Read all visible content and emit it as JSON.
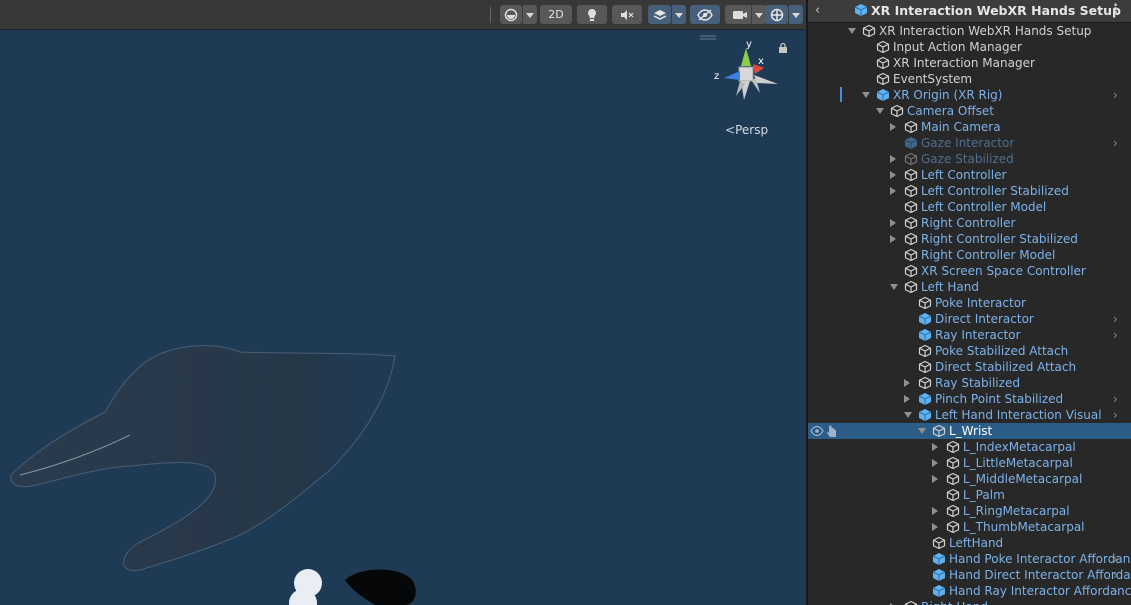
{
  "scene": {
    "toolbar": {
      "btn_2d": "2D"
    },
    "gizmo": {
      "x": "x",
      "y": "y",
      "z": "z"
    },
    "persp_label": "Persp"
  },
  "hierarchy": {
    "title": "XR Interaction WebXR Hands Setup",
    "items": [
      {
        "label": "XR Interaction WebXR Hands Setup",
        "depth": 0,
        "expand": "expanded",
        "icon": "outline",
        "color": "white",
        "chev": false
      },
      {
        "label": "Input Action Manager",
        "depth": 1,
        "expand": "none",
        "icon": "outline",
        "color": "white",
        "chev": false
      },
      {
        "label": "XR Interaction Manager",
        "depth": 1,
        "expand": "none",
        "icon": "outline",
        "color": "white",
        "chev": false
      },
      {
        "label": "EventSystem",
        "depth": 1,
        "expand": "none",
        "icon": "outline",
        "color": "white",
        "chev": false
      },
      {
        "label": "XR Origin (XR Rig)",
        "depth": 1,
        "expand": "expanded",
        "icon": "prefab",
        "color": "blue",
        "chev": true
      },
      {
        "label": "Camera Offset",
        "depth": 2,
        "expand": "expanded",
        "icon": "outline",
        "color": "blue",
        "chev": false
      },
      {
        "label": "Main Camera",
        "depth": 3,
        "expand": "collapsed",
        "icon": "outline",
        "color": "blue",
        "chev": false
      },
      {
        "label": "Gaze Interactor",
        "depth": 3,
        "expand": "none",
        "icon": "prefab",
        "color": "dim",
        "chev": true
      },
      {
        "label": "Gaze Stabilized",
        "depth": 3,
        "expand": "collapsed",
        "icon": "outline",
        "color": "dim",
        "chev": false
      },
      {
        "label": "Left Controller",
        "depth": 3,
        "expand": "collapsed",
        "icon": "outline",
        "color": "blue",
        "chev": false
      },
      {
        "label": "Left Controller Stabilized",
        "depth": 3,
        "expand": "collapsed",
        "icon": "outline",
        "color": "blue",
        "chev": false
      },
      {
        "label": "Left Controller Model",
        "depth": 3,
        "expand": "none",
        "icon": "outline",
        "color": "blue",
        "chev": false
      },
      {
        "label": "Right Controller",
        "depth": 3,
        "expand": "collapsed",
        "icon": "outline",
        "color": "blue",
        "chev": false
      },
      {
        "label": "Right Controller Stabilized",
        "depth": 3,
        "expand": "collapsed",
        "icon": "outline",
        "color": "blue",
        "chev": false
      },
      {
        "label": "Right Controller Model",
        "depth": 3,
        "expand": "none",
        "icon": "outline",
        "color": "blue",
        "chev": false
      },
      {
        "label": "XR Screen Space Controller",
        "depth": 3,
        "expand": "none",
        "icon": "outline",
        "color": "blue",
        "chev": false
      },
      {
        "label": "Left Hand",
        "depth": 3,
        "expand": "expanded",
        "icon": "outline",
        "color": "blue",
        "chev": false
      },
      {
        "label": "Poke Interactor",
        "depth": 4,
        "expand": "none",
        "icon": "outline",
        "color": "blue",
        "chev": false
      },
      {
        "label": "Direct Interactor",
        "depth": 4,
        "expand": "none",
        "icon": "prefab",
        "color": "blue",
        "chev": true
      },
      {
        "label": "Ray Interactor",
        "depth": 4,
        "expand": "none",
        "icon": "prefab",
        "color": "blue",
        "chev": true
      },
      {
        "label": "Poke Stabilized Attach",
        "depth": 4,
        "expand": "none",
        "icon": "outline",
        "color": "blue",
        "chev": false
      },
      {
        "label": "Direct Stabilized Attach",
        "depth": 4,
        "expand": "none",
        "icon": "outline",
        "color": "blue",
        "chev": false
      },
      {
        "label": "Ray Stabilized",
        "depth": 4,
        "expand": "collapsed",
        "icon": "outline",
        "color": "blue",
        "chev": false
      },
      {
        "label": "Pinch Point Stabilized",
        "depth": 4,
        "expand": "collapsed",
        "icon": "prefab",
        "color": "blue",
        "chev": true
      },
      {
        "label": "Left Hand Interaction Visual",
        "depth": 4,
        "expand": "expanded",
        "icon": "prefab",
        "color": "blue",
        "chev": true
      },
      {
        "label": "L_Wrist",
        "depth": 5,
        "expand": "expanded",
        "icon": "outline",
        "color": "white",
        "chev": false,
        "selected": true
      },
      {
        "label": "L_IndexMetacarpal",
        "depth": 6,
        "expand": "collapsed",
        "icon": "outline",
        "color": "blue",
        "chev": false
      },
      {
        "label": "L_LittleMetacarpal",
        "depth": 6,
        "expand": "collapsed",
        "icon": "outline",
        "color": "blue",
        "chev": false
      },
      {
        "label": "L_MiddleMetacarpal",
        "depth": 6,
        "expand": "collapsed",
        "icon": "outline",
        "color": "blue",
        "chev": false
      },
      {
        "label": "L_Palm",
        "depth": 6,
        "expand": "none",
        "icon": "outline",
        "color": "blue",
        "chev": false
      },
      {
        "label": "L_RingMetacarpal",
        "depth": 6,
        "expand": "collapsed",
        "icon": "outline",
        "color": "blue",
        "chev": false
      },
      {
        "label": "L_ThumbMetacarpal",
        "depth": 6,
        "expand": "collapsed",
        "icon": "outline",
        "color": "blue",
        "chev": false
      },
      {
        "label": "LeftHand",
        "depth": 5,
        "expand": "none",
        "icon": "outline",
        "color": "blue",
        "chev": false
      },
      {
        "label": "Hand Poke Interactor Affordance",
        "depth": 5,
        "expand": "none",
        "icon": "prefab",
        "color": "blue",
        "chev": true
      },
      {
        "label": "Hand Direct Interactor Affordance",
        "depth": 5,
        "expand": "none",
        "icon": "prefab",
        "color": "blue",
        "chev": true
      },
      {
        "label": "Hand Ray Interactor Affordance",
        "depth": 5,
        "expand": "none",
        "icon": "prefab",
        "color": "blue",
        "chev": true
      },
      {
        "label": "Right Hand",
        "depth": 3,
        "expand": "collapsed",
        "icon": "outline",
        "color": "blue",
        "chev": false
      }
    ]
  },
  "colors": {
    "scene_bg": "#1f3a55",
    "panel_bg": "#282828",
    "selected_row": "#2c5d87",
    "prefab_text": "#7cb2ea",
    "plain_text": "#d2d2d2",
    "axis_x": "#e5483b",
    "axis_y": "#8cd04a",
    "axis_z": "#3b82e5"
  }
}
